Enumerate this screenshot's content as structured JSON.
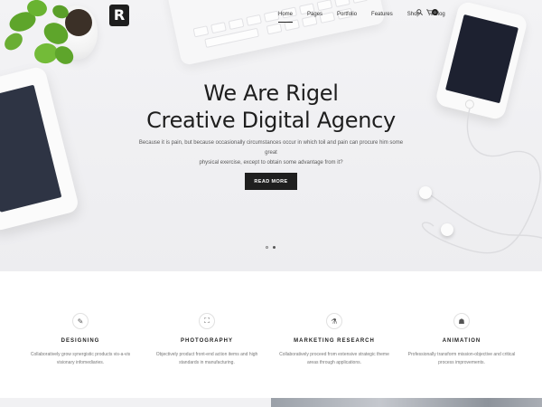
{
  "nav": {
    "items": [
      {
        "label": "Home",
        "active": true
      },
      {
        "label": "Pages",
        "active": false
      },
      {
        "label": "Portfolio",
        "active": false
      },
      {
        "label": "Features",
        "active": false
      },
      {
        "label": "Shop",
        "active": false
      },
      {
        "label": "Blog",
        "active": false
      }
    ],
    "search_icon": "search-icon",
    "cart_icon": "cart-icon",
    "cart_count": "0"
  },
  "logo": {
    "glyph": "R"
  },
  "hero": {
    "title_line1": "We Are Rigel",
    "title_line2": "Creative Digital Agency",
    "subtitle_line1": "Because it is pain, but because occasionally circumstances occur in which toil and pain can procure him some great",
    "subtitle_line2": "physical exercise, except to obtain some advantage from it?",
    "button_label": "READ MORE",
    "slides": 2,
    "active_slide": 1
  },
  "services": [
    {
      "icon": "pen-icon",
      "glyph": "✎",
      "title": "DESIGNING",
      "desc": "Collaboratively grow synergistic products vis-a-vis visionary infomediaries."
    },
    {
      "icon": "camera-frame-icon",
      "glyph": "⛶",
      "title": "PHOTOGRAPHY",
      "desc": "Objectively product front-end action items and high standards in manufacturing."
    },
    {
      "icon": "flask-icon",
      "glyph": "⚗",
      "title": "MARKETING RESEARCH",
      "desc": "Collaboratively proceed from extensive strategic theme areas through applications."
    },
    {
      "icon": "ghost-icon",
      "glyph": "☗",
      "title": "ANIMATION",
      "desc": "Professionally transform mission-objective and critical process improvements."
    }
  ]
}
